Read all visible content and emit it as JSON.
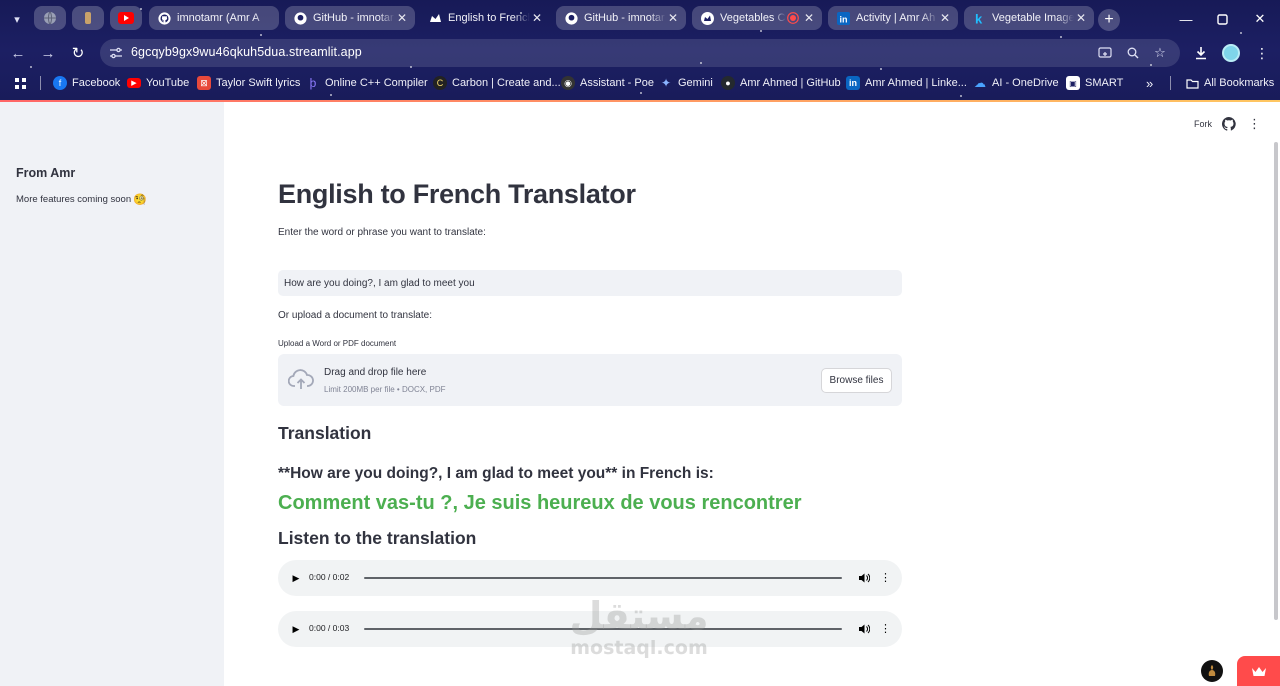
{
  "browser": {
    "tabs": [
      {
        "title": "imnotamr (Amr A",
        "icon": "github-icon",
        "active": false
      },
      {
        "title": "GitHub - imnotar",
        "icon": "github-icon",
        "active": false
      },
      {
        "title": "English to French",
        "icon": "streamlit-icon",
        "active": true
      },
      {
        "title": "GitHub - imnotar",
        "icon": "github-icon",
        "active": false
      },
      {
        "title": "Vegetables Cl",
        "icon": "streamlit-icon",
        "active": false,
        "recording": true
      },
      {
        "title": "Activity | Amr Ah",
        "icon": "linkedin-icon",
        "active": false
      },
      {
        "title": "Vegetable Image",
        "icon": "kaggle-icon",
        "active": false
      }
    ],
    "url": "6gcqyb9gx9wu46qkuh5dua.streamlit.app",
    "bookmarks": [
      {
        "label": "Facebook",
        "icon": "facebook-icon",
        "color": "#1877f2"
      },
      {
        "label": "YouTube",
        "icon": "youtube-icon",
        "color": "#ff0000"
      },
      {
        "label": "Taylor Swift lyrics",
        "icon": "lyrics-icon",
        "color": "#e8493b"
      },
      {
        "label": "Online C++ Compiler",
        "icon": "compiler-icon",
        "color": "#6b4cf6"
      },
      {
        "label": "Carbon | Create and...",
        "icon": "carbon-icon",
        "color": "#222222"
      },
      {
        "label": "Assistant - Poe",
        "icon": "poe-icon",
        "color": "#333333"
      },
      {
        "label": "Gemini",
        "icon": "gemini-icon",
        "color": "#7aa6ff"
      },
      {
        "label": "Amr Ahmed | GitHub",
        "icon": "github-icon",
        "color": "#24292e"
      },
      {
        "label": "Amr Ahmed | Linke...",
        "icon": "linkedin-icon",
        "color": "#0a66c2"
      },
      {
        "label": "AI - OneDrive",
        "icon": "onedrive-icon",
        "color": "#0f78d4"
      },
      {
        "label": "SMART",
        "icon": "smart-icon",
        "color": "#ffffff"
      }
    ],
    "more_bookmarks": "»",
    "all_bookmarks": "All Bookmarks"
  },
  "sidebar": {
    "title": "From Amr",
    "text": "More features coming soon",
    "emoji": "🧐"
  },
  "header": {
    "fork_label": "Fork"
  },
  "main": {
    "title": "English to French Translator",
    "input_label": "Enter the word or phrase you want to translate:",
    "input_value": "How are you doing?, I am glad to meet you",
    "upload_intro": "Or upload a document to translate:",
    "uploader_label": "Upload a Word or PDF document",
    "dropzone_title": "Drag and drop file here",
    "dropzone_sub": "Limit 200MB per file • DOCX, PDF",
    "browse_label": "Browse files",
    "translation_header": "Translation",
    "result_prefix": "**How are you doing?, I am glad to meet you** in French is:",
    "result_text": "Comment vas-tu ?, Je suis heureux de vous rencontrer",
    "listen_header": "Listen to the translation",
    "audio_players": [
      {
        "time": "0:00 / 0:02",
        "progress": 0
      },
      {
        "time": "0:00 / 0:03",
        "progress": 0
      }
    ]
  },
  "watermark": {
    "arabic": "مستقل",
    "latin": "mostaql.com"
  },
  "colors": {
    "accent_green": "#4caf50",
    "streamlit_red": "#ff4b4b",
    "sidebar_bg": "#f0f2f6",
    "chrome_bg": "#1c1f63"
  }
}
